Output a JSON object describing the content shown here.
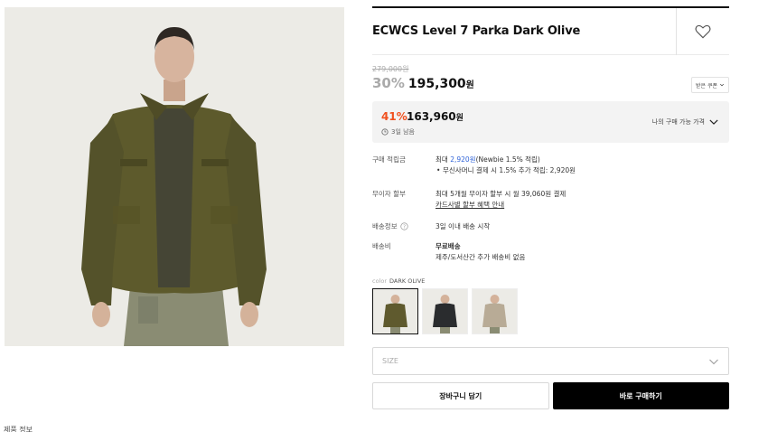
{
  "product": {
    "title": "ECWCS Level 7 Parka Dark Olive",
    "original_price": "279,000원",
    "discount_rate": "30%",
    "sale_price": "195,300",
    "won": "원",
    "coupon_label": "받은 쿠폰"
  },
  "benefit": {
    "rate": "41%",
    "price": "163,960",
    "won": "원",
    "timer": "3일 남음",
    "toggle_label": "나의 구매 가능 가격"
  },
  "info": {
    "points_label": "구매 적립금",
    "points_prefix": "최대 ",
    "points_amount": "2,920원",
    "points_suffix": "(Newbie 1.5% 적립)",
    "points_bullet": "무신사머니 결제 시 1.5% 추가 적립: 2,920원",
    "installment_label": "무이자 할부",
    "installment_text": "최대 5개월 무이자 할부 시 월 39,060원 결제",
    "installment_link": "카드사별 할부 혜택 안내",
    "shipping_label": "배송정보",
    "shipping_text": "3일 이내 배송 시작",
    "fee_label": "배송비",
    "fee_title": "무료배송",
    "fee_text": "제주/도서산간 추가 배송비 없음"
  },
  "color": {
    "key": "color",
    "value": "DARK OLIVE",
    "swatches": [
      {
        "name": "dark-olive",
        "jacket": "#5f5a2e",
        "active": true
      },
      {
        "name": "black",
        "jacket": "#2a2c2e",
        "active": false
      },
      {
        "name": "beige",
        "jacket": "#b8ab96",
        "active": false
      }
    ]
  },
  "size": {
    "placeholder": "SIZE"
  },
  "actions": {
    "cart_label": "장바구니 담기",
    "buy_label": "바로 구매하기"
  },
  "footer": {
    "label": "제품 정보"
  },
  "colors": {
    "accent_orange": "#f0501e",
    "link_blue": "#2f63d8",
    "buy_button": "#000000"
  }
}
